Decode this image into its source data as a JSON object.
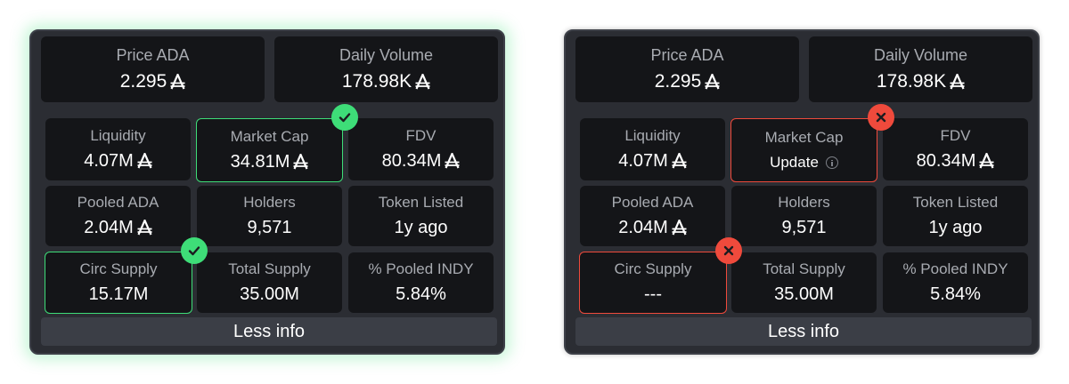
{
  "currency_symbol": "₳",
  "colors": {
    "success": "#3edd78",
    "error": "#ef4a3c",
    "panel": "#2b2d33",
    "cell": "#141518"
  },
  "left": {
    "price_label": "Price ADA",
    "price_value": "2.295",
    "volume_label": "Daily Volume",
    "volume_value": "178.98K",
    "liquidity_label": "Liquidity",
    "liquidity_value": "4.07M",
    "mcap_label": "Market Cap",
    "mcap_value": "34.81M",
    "fdv_label": "FDV",
    "fdv_value": "80.34M",
    "pooled_label": "Pooled ADA",
    "pooled_value": "2.04M",
    "holders_label": "Holders",
    "holders_value": "9,571",
    "listed_label": "Token Listed",
    "listed_value": "1y ago",
    "circ_label": "Circ Supply",
    "circ_value": "15.17M",
    "total_label": "Total Supply",
    "total_value": "35.00M",
    "pooled_indy_label": "% Pooled INDY",
    "pooled_indy_value": "5.84%",
    "less_info": "Less info"
  },
  "right": {
    "price_label": "Price ADA",
    "price_value": "2.295",
    "volume_label": "Daily Volume",
    "volume_value": "178.98K",
    "liquidity_label": "Liquidity",
    "liquidity_value": "4.07M",
    "mcap_label": "Market Cap",
    "mcap_update": "Update",
    "fdv_label": "FDV",
    "fdv_value": "80.34M",
    "pooled_label": "Pooled ADA",
    "pooled_value": "2.04M",
    "holders_label": "Holders",
    "holders_value": "9,571",
    "listed_label": "Token Listed",
    "listed_value": "1y ago",
    "circ_label": "Circ Supply",
    "circ_value": "---",
    "total_label": "Total Supply",
    "total_value": "35.00M",
    "pooled_indy_label": "% Pooled INDY",
    "pooled_indy_value": "5.84%",
    "less_info": "Less info"
  }
}
